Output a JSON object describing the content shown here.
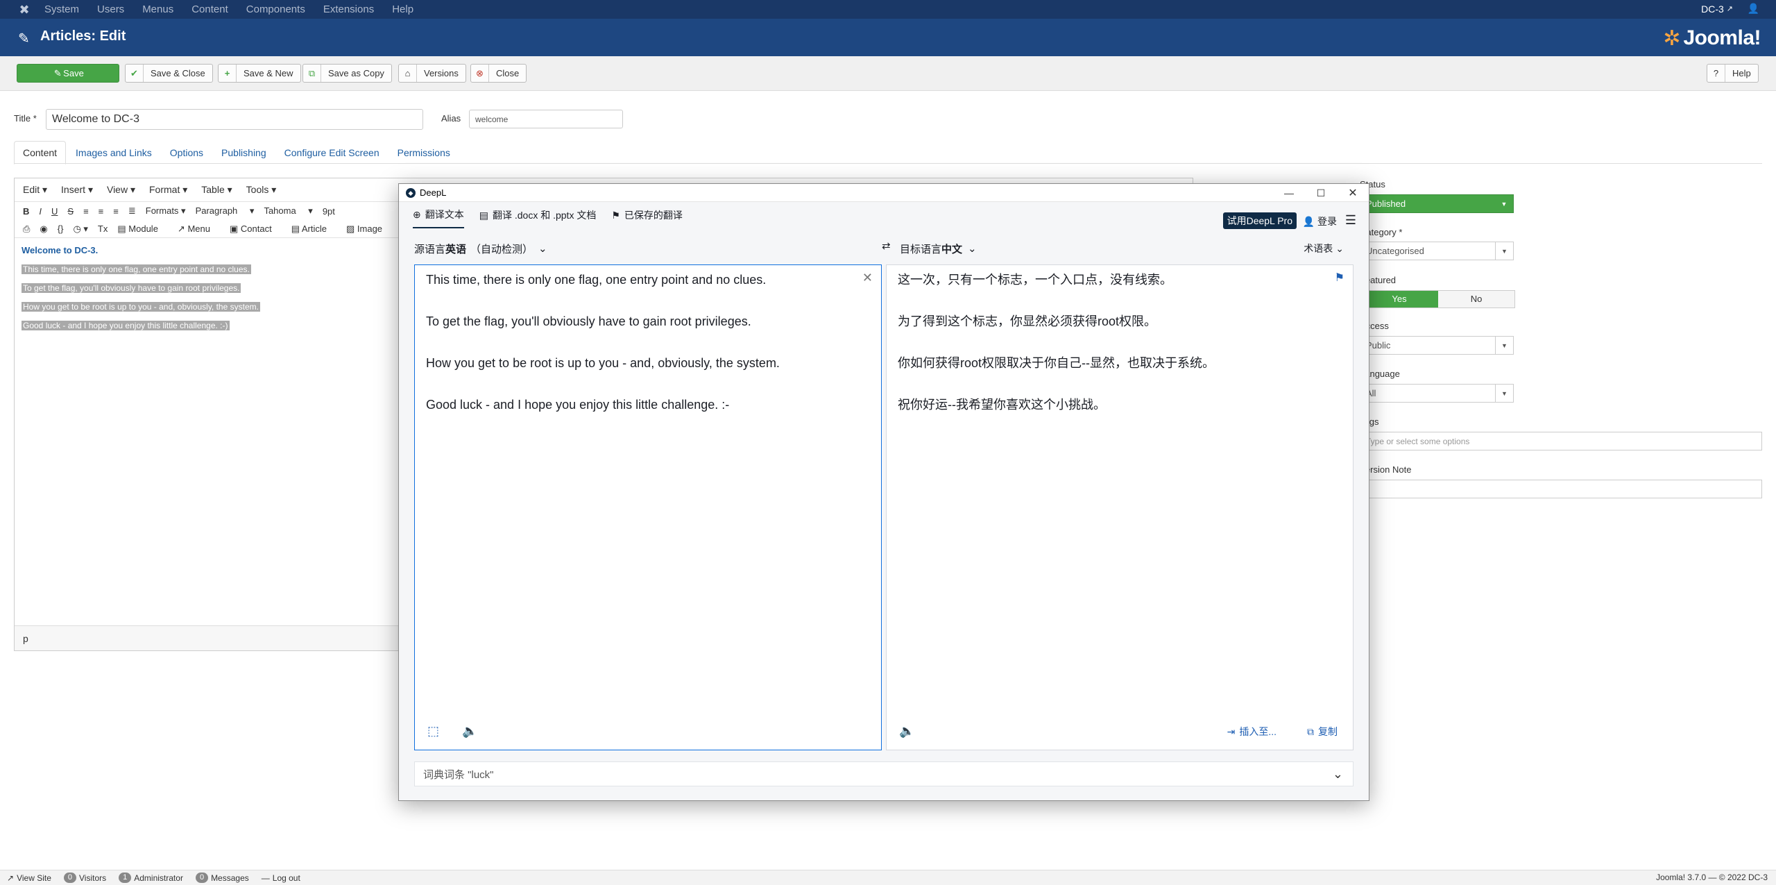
{
  "topbar": {
    "menu": [
      "System",
      "Users",
      "Menus",
      "Content",
      "Components",
      "Extensions",
      "Help"
    ],
    "site": "DC-3"
  },
  "header": {
    "title": "Articles: Edit",
    "logo_text": "Joomla!"
  },
  "toolbar": {
    "save": "Save",
    "save_close": "Save & Close",
    "save_new": "Save & New",
    "save_copy": "Save as Copy",
    "versions": "Versions",
    "close": "Close",
    "help": "Help"
  },
  "form": {
    "title_label": "Title *",
    "title_value": "Welcome to DC-3",
    "alias_label": "Alias",
    "alias_value": "welcome"
  },
  "tabs": [
    "Content",
    "Images and Links",
    "Options",
    "Publishing",
    "Configure Edit Screen",
    "Permissions"
  ],
  "editor": {
    "menubar": [
      "Edit ▾",
      "Insert ▾",
      "View ▾",
      "Format ▾",
      "Table ▾",
      "Tools ▾"
    ],
    "formats": "Formats ▾",
    "paragraph": "Paragraph",
    "font": "Tahoma",
    "size": "9pt",
    "insert_buttons": [
      "Module",
      "Menu",
      "Contact",
      "Article",
      "Image"
    ],
    "heading": "Welcome to DC-3.",
    "lines": [
      "This time, there is only one flag, one entry point and no clues.",
      "To get the flag, you'll obviously have to gain root privileges.",
      "How you get to be root is up to you - and, obviously, the system.",
      "Good luck - and I hope you enjoy this little challenge.  :-)"
    ],
    "status_path": "p"
  },
  "sidebar": {
    "status_label": "Status",
    "status_value": "Published",
    "category_label": "Category *",
    "category_value": "Uncategorised",
    "featured_label": "Featured",
    "featured_yes": "Yes",
    "featured_no": "No",
    "access_label": "Access",
    "access_value": "Public",
    "language_label": "Language",
    "language_value": "All",
    "tags_label": "Tags",
    "tags_placeholder": "Type or select some options",
    "version_label": "Version Note"
  },
  "footer": {
    "view_site": "View Site",
    "visitors_count": "0",
    "visitors": "Visitors",
    "admin_count": "1",
    "admin": "Administrator",
    "messages_count": "0",
    "messages": "Messages",
    "logout": "Log out",
    "copyright": "Joomla! 3.7.0 — © 2022 DC-3"
  },
  "deepl": {
    "window_title": "DeepL",
    "nav": [
      "翻译文本",
      "翻译 .docx 和 .pptx 文档",
      "已保存的翻译"
    ],
    "pro_button": "试用DeepL Pro",
    "login": "登录",
    "source_lang_prefix": "源语言",
    "source_lang": "英语",
    "source_detect": "（自动检测）",
    "target_lang_prefix": "目标语言",
    "target_lang": "中文",
    "glossary": "术语表",
    "source_lines": [
      "This time, there is only one flag, one entry point and no clues.",
      "To get the flag, you'll obviously have to gain root privileges.",
      "How you get to be root is up to you - and, obviously, the system.",
      "Good luck - and I hope you enjoy this little challenge.  :-"
    ],
    "target_lines": [
      "这一次，只有一个标志，一个入口点，没有线索。",
      "为了得到这个标志，你显然必须获得root权限。",
      "你如何获得root权限取决于你自己--显然，也取决于系统。",
      "祝你好运--我希望你喜欢这个小挑战。"
    ],
    "insert_to": "插入至...",
    "copy": "复制",
    "dict_entry": "词典词条 \"luck\""
  },
  "colors": {
    "joomla_nav": "#1a3867",
    "joomla_header": "#1e4781",
    "save_green": "#46a546",
    "deepl_navy": "#0f2b46"
  }
}
